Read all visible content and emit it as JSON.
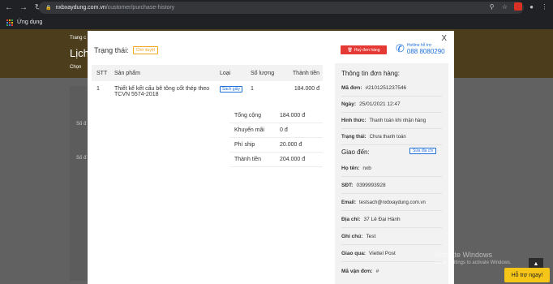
{
  "browser": {
    "url_host": "nxbxaydung.com.vn",
    "url_path": "/customer/purchase-history",
    "bookmark_label": "Ứng dụng"
  },
  "background": {
    "breadcrumb": "Trang c",
    "heading": "Lịch",
    "sub": "Chọn",
    "side_a": "Số đ",
    "side_b": "Số đ"
  },
  "modal": {
    "close_label": "X",
    "status_label": "Trạng thái:",
    "status_value": "Chờ duyệt",
    "cancel_label": "Huỷ đơn hàng",
    "hotline_label": "Hotline hỗ trợ",
    "hotline_number": "088 8080290",
    "table": {
      "headers": [
        "STT",
        "Sản phẩm",
        "Loại",
        "Số lượng",
        "Thành tiền"
      ],
      "rows": [
        {
          "stt": "1",
          "product": "Thiết kế kết cấu bê tông cốt thép theo TCVN 5574-2018",
          "type": "Sách giấy",
          "qty": "1",
          "price": "184.000 đ"
        }
      ]
    },
    "summary": [
      {
        "label": "Tổng cộng",
        "value": "184.000 đ"
      },
      {
        "label": "Khuyến mãi",
        "value": "0 đ"
      },
      {
        "label": "Phí ship",
        "value": "20.000 đ"
      },
      {
        "label": "Thành tiền",
        "value": "204.000 đ"
      }
    ],
    "order_info": {
      "title": "Thông tin đơn hàng:",
      "order_id_label": "Mã đơn:",
      "order_id": "#2101251237546",
      "date_label": "Ngày:",
      "date": "25/01/2021 12:47",
      "payment_label": "Hình thức:",
      "payment": "Thanh toán khi nhận hàng",
      "state_label": "Trạng thái:",
      "state": "Chưa thanh toán"
    },
    "delivery": {
      "title": "Giao đến:",
      "edit_label": "Sửa địa chỉ",
      "name_label": "Họ tên:",
      "name": "nxb",
      "phone_label": "SĐT:",
      "phone": "0399993928",
      "email_label": "Email:",
      "email": "testsach@nxbxaydung.com.vn",
      "address_label": "Địa chỉ:",
      "address": "37 Lê Đại Hành",
      "note_label": "Ghi chú:",
      "note": "Test",
      "carrier_label": "Giao qua:",
      "carrier": "Viettel Post",
      "tracking_label": "Mã vận đơn:",
      "tracking": "#"
    }
  },
  "watermark": {
    "line1": "Activate Windows",
    "line2": "Go to Settings to activate Windows."
  },
  "support_label": "Hỗ trợ ngay!",
  "colors": {
    "accent": "#1e6fd9",
    "danger": "#e53935",
    "pending": "#f5a623",
    "support": "#f5c518"
  }
}
